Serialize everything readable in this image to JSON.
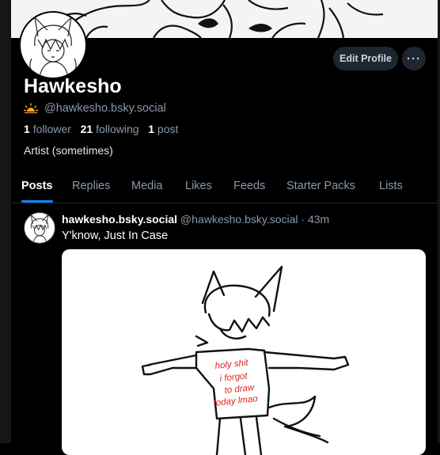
{
  "profile": {
    "display_name": "Hawkesho",
    "handle": "@hawkesho.bsky.social",
    "stats": {
      "followers_count": "1",
      "followers_label": "follower",
      "following_count": "21",
      "following_label": "following",
      "posts_count": "1",
      "posts_label": "post"
    },
    "bio": "Artist (sometimes)",
    "badge_icon": "sunrise-icon"
  },
  "actions": {
    "edit_label": "Edit Profile",
    "more_label": "···"
  },
  "tabs": [
    {
      "label": "Posts",
      "active": true
    },
    {
      "label": "Replies"
    },
    {
      "label": "Media"
    },
    {
      "label": "Likes"
    },
    {
      "label": "Feeds"
    },
    {
      "label": "Starter Packs"
    },
    {
      "label": "Lists"
    }
  ],
  "post": {
    "author_name": "hawkesho.bsky.social",
    "author_handle": "@hawkesho.bsky.social",
    "separator": "·",
    "time": "43m",
    "text": "Y'know, Just In Case",
    "image_text": [
      "holy shit",
      "i forgot",
      "to draw",
      "today lmao"
    ]
  },
  "colors": {
    "accent": "#1083fe",
    "button_bg": "#1e2630",
    "muted_text": "#8a99aa",
    "drawing_text": "#e0231c"
  }
}
